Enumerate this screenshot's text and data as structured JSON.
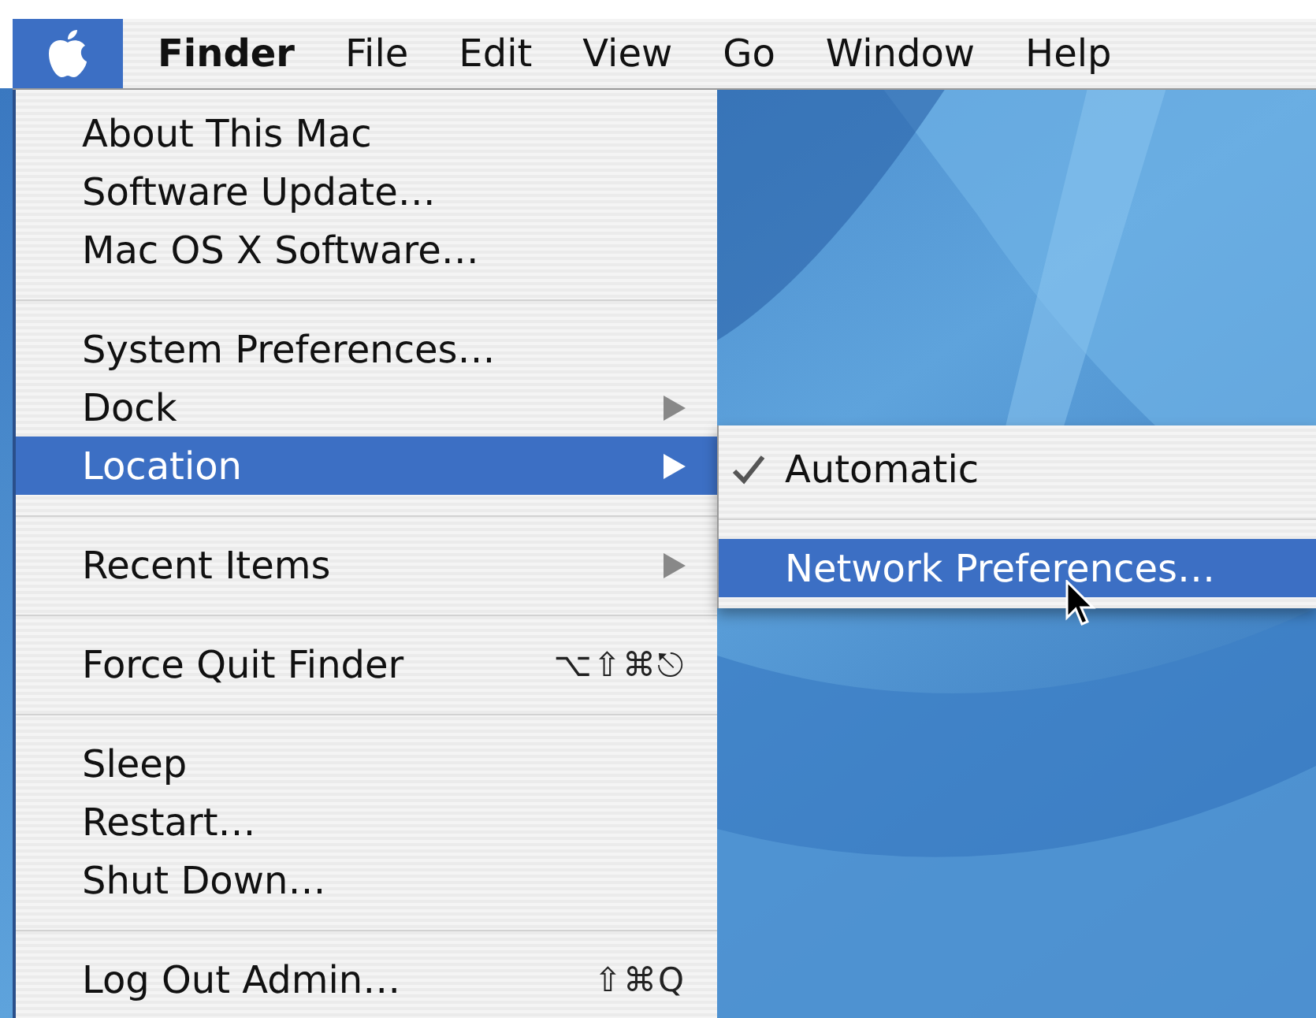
{
  "menu_bar": {
    "apple_menu": {
      "selected": true
    },
    "items": [
      {
        "label": "Finder",
        "kind": "app"
      },
      {
        "label": "File",
        "kind": "menu"
      },
      {
        "label": "Edit",
        "kind": "menu"
      },
      {
        "label": "View",
        "kind": "menu"
      },
      {
        "label": "Go",
        "kind": "menu"
      },
      {
        "label": "Window",
        "kind": "menu"
      },
      {
        "label": "Help",
        "kind": "menu"
      }
    ]
  },
  "apple_menu": {
    "items": [
      {
        "kind": "item",
        "label": "About This Mac",
        "selected": false
      },
      {
        "kind": "item",
        "label": "Software Update…",
        "selected": false
      },
      {
        "kind": "item",
        "label": "Mac OS X Software…",
        "selected": false
      },
      {
        "kind": "separator"
      },
      {
        "kind": "item",
        "label": "System Preferences…",
        "selected": false
      },
      {
        "kind": "submenu",
        "label": "Dock",
        "selected": false
      },
      {
        "kind": "submenu",
        "label": "Location",
        "selected": true
      },
      {
        "kind": "separator"
      },
      {
        "kind": "submenu",
        "label": "Recent Items",
        "selected": false
      },
      {
        "kind": "separator"
      },
      {
        "kind": "item",
        "label": "Force Quit Finder",
        "shortcut": "⌥⇧⌘⎋",
        "selected": false
      },
      {
        "kind": "separator"
      },
      {
        "kind": "item",
        "label": "Sleep",
        "selected": false
      },
      {
        "kind": "item",
        "label": "Restart…",
        "selected": false
      },
      {
        "kind": "item",
        "label": "Shut Down…",
        "selected": false
      },
      {
        "kind": "separator"
      },
      {
        "kind": "item",
        "label": "Log Out Admin…",
        "shortcut": "⇧⌘Q",
        "selected": false
      }
    ]
  },
  "location_submenu": {
    "items": [
      {
        "kind": "item",
        "label": "Automatic",
        "checked": true,
        "selected": false
      },
      {
        "kind": "separator"
      },
      {
        "kind": "item",
        "label": "Network Preferences…",
        "checked": false,
        "selected": true
      }
    ]
  }
}
